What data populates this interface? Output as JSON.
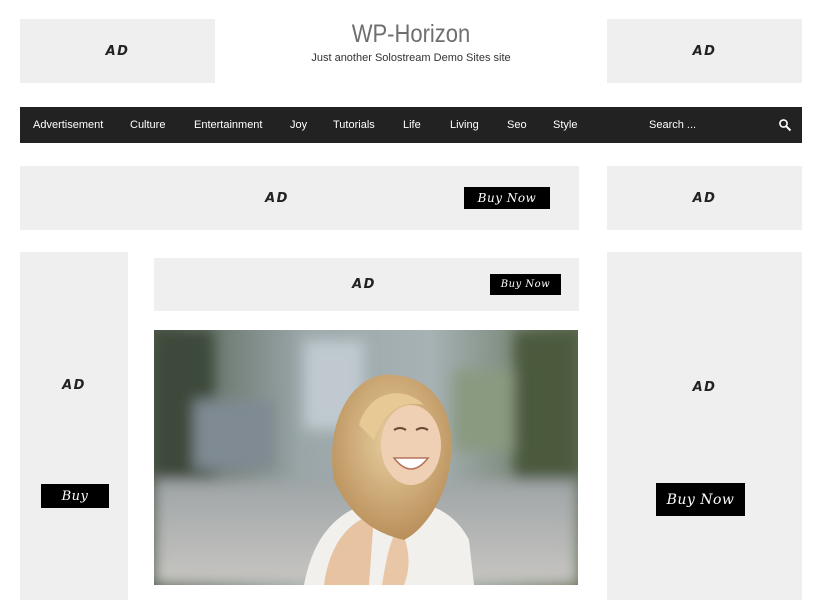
{
  "site": {
    "title": "WP-Horizon",
    "description": "Just another Solostream Demo Sites site"
  },
  "nav": {
    "items": [
      {
        "label": "Advertisement"
      },
      {
        "label": "Culture"
      },
      {
        "label": "Entertainment"
      },
      {
        "label": "Joy"
      },
      {
        "label": "Tutorials"
      },
      {
        "label": "Life"
      },
      {
        "label": "Living"
      },
      {
        "label": "Seo"
      },
      {
        "label": "Style"
      }
    ],
    "search_placeholder": "Search ...",
    "search_icon": "search-icon"
  },
  "ads": {
    "header_left": {
      "label": "AD"
    },
    "header_right": {
      "label": "AD"
    },
    "banner_wide": {
      "label": "AD",
      "button": "Buy Now"
    },
    "sidebar_right_top": {
      "label": "AD"
    },
    "skyscraper_left": {
      "label": "AD",
      "button": "Buy"
    },
    "banner_inner": {
      "label": "AD",
      "button": "Buy Now"
    },
    "skyscraper_right": {
      "label": "AD",
      "button": "Buy Now"
    }
  },
  "colors": {
    "nav_background": "#222222",
    "ad_background": "#efefef",
    "button_background": "#000000",
    "title_color": "#6f6f6f"
  },
  "featured_image": {
    "icon": "photo-laughing-woman"
  }
}
